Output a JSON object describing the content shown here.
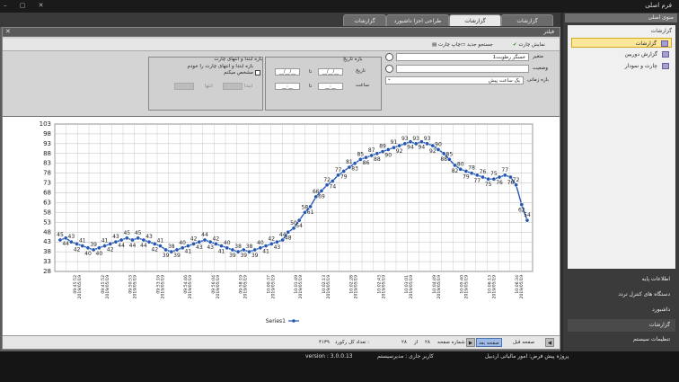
{
  "window": {
    "title": "فرم اصلی",
    "controls": "– ▢ ✕"
  },
  "tabs": [
    {
      "label": "گزارشات"
    },
    {
      "label": "گزارشات"
    },
    {
      "label": "طراحی اجزا داشبورد"
    },
    {
      "label": "گزارشات"
    }
  ],
  "filter": {
    "title": "فیلتر",
    "collapse": "✕"
  },
  "toolbar": {
    "show_chart": "نمایش چارت",
    "new_search": "جستجو جدید",
    "print_chart": "چاپ چارت"
  },
  "form": {
    "field1": {
      "label": "متغیر",
      "value": "خسگر رطوبت1"
    },
    "field2": {
      "label": "وضعیت",
      "value": ""
    },
    "field3": {
      "label": "بازه زمانی",
      "value": "یک ساعت پیش"
    },
    "date_group": {
      "title": "بازه تاریخ",
      "from": "تاریخ",
      "from_val": "__/__/__",
      "to": "تا",
      "to_val": "__/__/__",
      "time_label": "ساعت",
      "time_from": "__:__",
      "time_to": "__:__"
    },
    "range_group": {
      "title": "بازه ابتدا و انتهای چارت",
      "check_label": "بازه ابتدا و انتهای چارت را خودم مشخص میکنم",
      "start": "ابتدا",
      "end": "انتها"
    }
  },
  "chart_data": {
    "type": "line",
    "ylim": [
      28,
      103
    ],
    "yticks": [
      28,
      33,
      38,
      43,
      48,
      53,
      58,
      63,
      68,
      73,
      78,
      83,
      88,
      93,
      98,
      103
    ],
    "xtick_labels": [
      [
        "09:45:52",
        "2019/05/19"
      ],
      [
        "09:45:52",
        "2019/05/19"
      ],
      [
        "09:50:53",
        "2019/05/19"
      ],
      [
        "09:53:16",
        "2019/05/19"
      ],
      [
        "09:54:46",
        "2019/05/19"
      ],
      [
        "09:56:04",
        "2019/05/19"
      ],
      [
        "09:58:19",
        "2019/05/19"
      ],
      [
        "10:00:37",
        "2019/05/19"
      ],
      [
        "10:01:49",
        "2019/05/19"
      ],
      [
        "10:02:13",
        "2019/05/19"
      ],
      [
        "10:02:28",
        "2019/05/19"
      ],
      [
        "10:02:43",
        "2019/05/19"
      ],
      [
        "10:03:01",
        "2019/05/19"
      ],
      [
        "10:04:49",
        "2019/05/19"
      ],
      [
        "10:05:40",
        "2019/05/19"
      ],
      [
        "10:06:13",
        "2019/05/19"
      ],
      [
        "10:06:34",
        "2019/05/19"
      ]
    ],
    "series": [
      {
        "name": "Series1",
        "values": [
          44,
          45,
          43,
          42,
          41,
          40,
          39,
          40,
          41,
          42,
          43,
          44,
          45,
          44,
          45,
          44,
          43,
          42,
          41,
          39,
          38,
          39,
          40,
          41,
          42,
          43,
          44,
          43,
          42,
          41,
          40,
          39,
          38,
          39,
          38,
          39,
          40,
          41,
          42,
          43,
          44,
          48,
          50,
          54,
          58,
          61,
          66,
          69,
          72,
          74,
          77,
          79,
          81,
          83,
          85,
          86,
          87,
          88,
          89,
          90,
          91,
          92,
          93,
          94,
          93,
          94,
          93,
          92,
          90,
          88,
          85,
          82,
          80,
          79,
          78,
          77,
          76,
          75,
          75,
          76,
          77,
          76,
          72,
          62,
          54
        ]
      }
    ],
    "labeled_values": [
      45,
      44,
      43,
      42,
      41,
      40,
      39,
      40,
      41,
      42,
      43,
      44,
      45,
      44,
      45,
      44,
      43,
      42,
      41,
      39,
      38,
      39,
      40,
      41,
      42,
      43,
      44,
      43,
      42,
      41,
      40,
      39,
      38,
      39,
      38,
      39,
      40,
      41,
      42,
      43,
      44,
      48,
      50,
      54,
      58,
      61,
      66,
      69,
      72,
      74,
      77,
      79,
      81,
      83,
      85,
      86,
      87,
      88,
      89,
      90,
      91,
      92,
      93,
      94,
      93,
      94,
      93,
      92,
      90,
      88,
      85,
      82,
      80,
      79,
      78,
      77,
      76,
      75,
      75,
      76,
      77,
      76,
      72,
      62,
      54
    ],
    "legend": "Series1"
  },
  "pager": {
    "prev": "صفحه قبل",
    "next": "صفحه بعد",
    "page_label": "شماره صفحه",
    "page": "۲۸",
    "of": "از",
    "total_pages": "۲۸",
    "records_label": "تعداد کل رکورد :",
    "records": "۴۱۳۹"
  },
  "status": {
    "version": "version : 3.0.0.13",
    "user": "کاربر جاری : مدیرسیستم",
    "project": "پروژه پیش فرض: امور مالیاتی اردبیل"
  },
  "sidebar": {
    "title": "منوی اصلی",
    "section": "گزارشات",
    "items": [
      {
        "label": "گزارشات"
      },
      {
        "label": "گزارش دوربین"
      },
      {
        "label": "چارت و نمودار"
      }
    ],
    "menus": [
      {
        "label": "اطلاعات پایه"
      },
      {
        "label": "دستگاه های کنترل تردد"
      },
      {
        "label": "داشبورد"
      },
      {
        "label": "گزارشات"
      },
      {
        "label": "تنظیمات سیستم"
      }
    ]
  },
  "colors": {
    "series": "#2457b3",
    "accent": "#ffe79a"
  }
}
